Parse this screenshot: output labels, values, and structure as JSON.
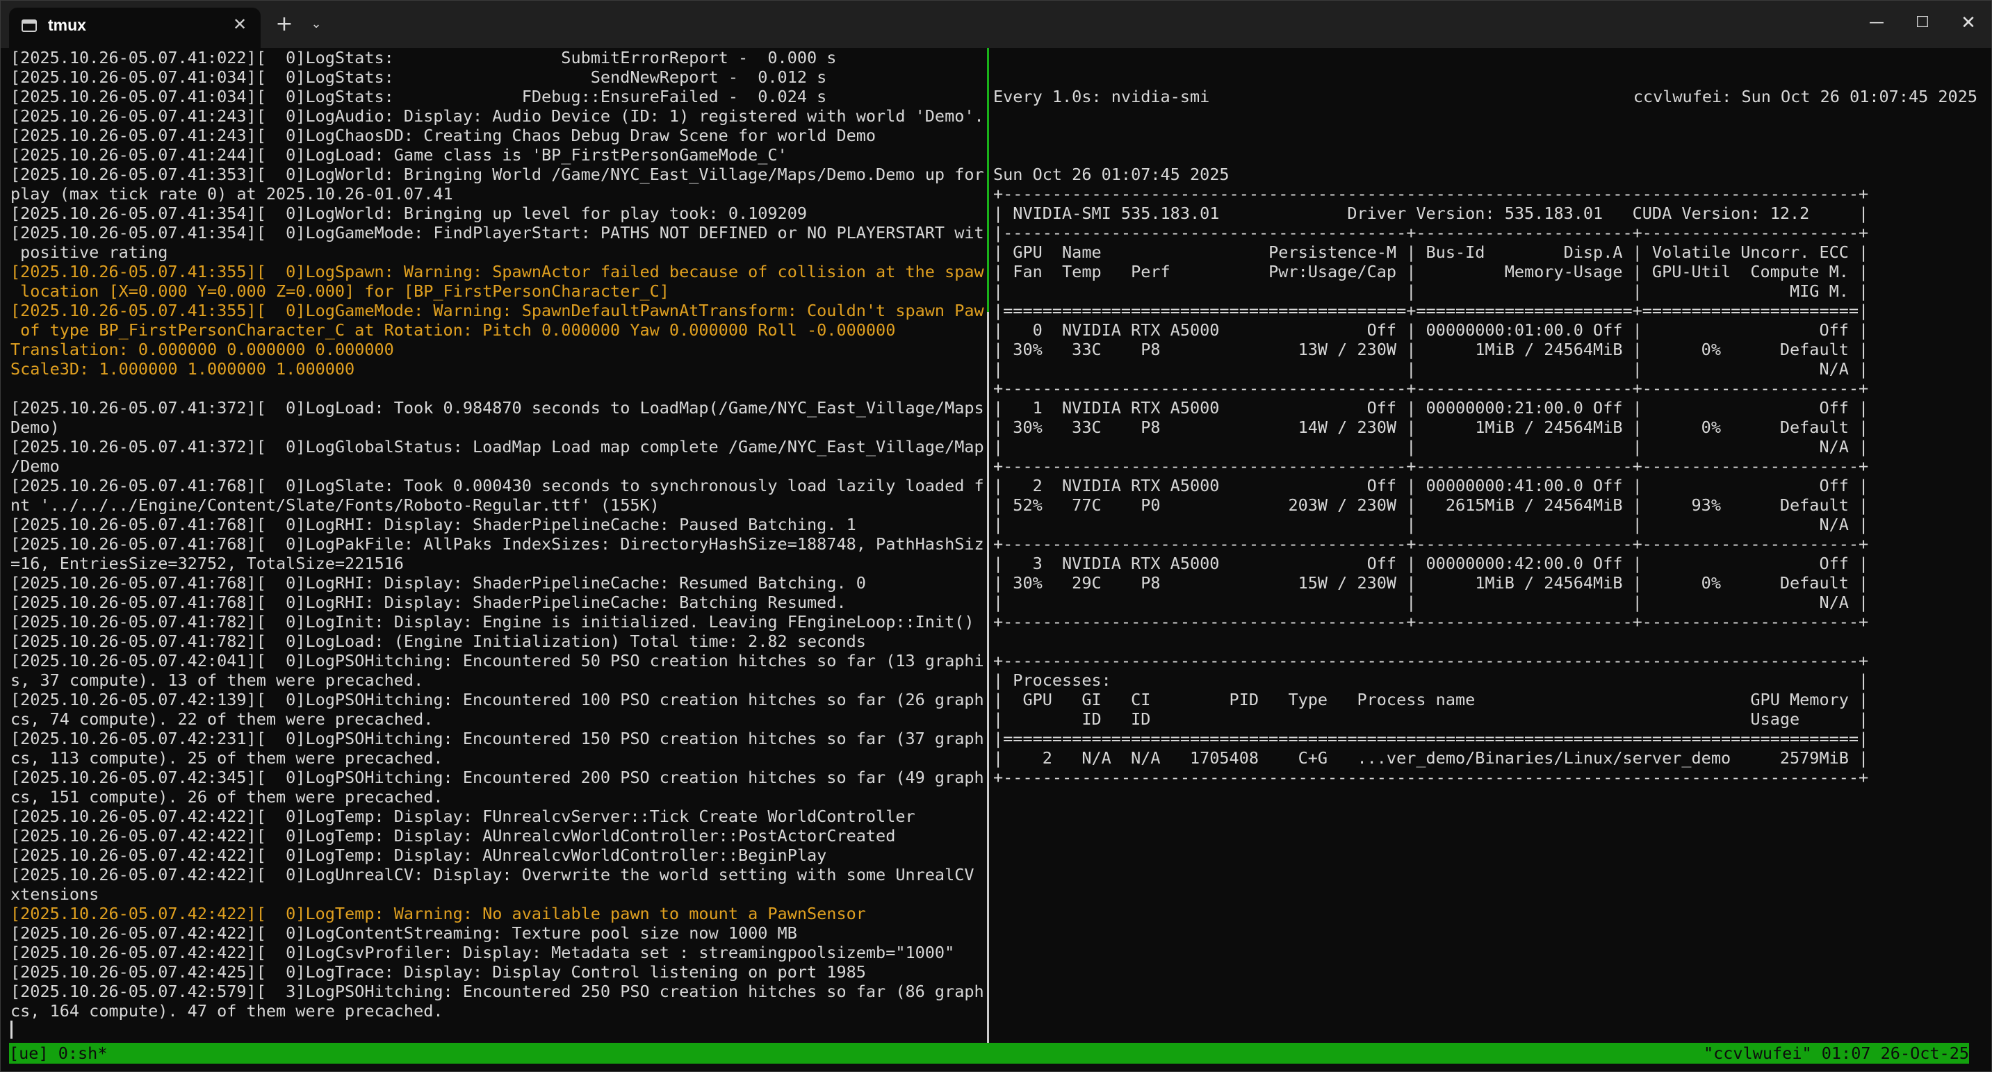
{
  "window": {
    "tab_title": "tmux",
    "tab_close_glyph": "✕",
    "new_tab_glyph": "+",
    "dropdown_glyph": "⌄",
    "minimize_glyph": "—",
    "maximize_glyph": "☐",
    "close_glyph": "✕",
    "icons": {
      "tab": "terminal-icon",
      "close": "close-icon",
      "new_tab": "plus-icon",
      "dropdown": "chevron-down-icon"
    }
  },
  "colors": {
    "background": "#0c0c0c",
    "text": "#d8d8d8",
    "warning": "#e0a020",
    "status_bar": "#13a10e",
    "active_divider": "#19b319"
  },
  "left_pane": {
    "lines": [
      {
        "text": "[2025.10.26-05.07.41:022][  0]LogStats:                 SubmitErrorReport -  0.000 s",
        "warn": false
      },
      {
        "text": "[2025.10.26-05.07.41:034][  0]LogStats:                    SendNewReport -  0.012 s",
        "warn": false
      },
      {
        "text": "[2025.10.26-05.07.41:034][  0]LogStats:             FDebug::EnsureFailed -  0.024 s",
        "warn": false
      },
      {
        "text": "[2025.10.26-05.07.41:243][  0]LogAudio: Display: Audio Device (ID: 1) registered with world 'Demo'.",
        "warn": false
      },
      {
        "text": "[2025.10.26-05.07.41:243][  0]LogChaosDD: Creating Chaos Debug Draw Scene for world Demo",
        "warn": false
      },
      {
        "text": "[2025.10.26-05.07.41:244][  0]LogLoad: Game class is 'BP_FirstPersonGameMode_C'",
        "warn": false
      },
      {
        "text": "[2025.10.26-05.07.41:353][  0]LogWorld: Bringing World /Game/NYC_East_Village/Maps/Demo.Demo up for",
        "warn": false
      },
      {
        "text": "play (max tick rate 0) at 2025.10.26-01.07.41",
        "warn": false
      },
      {
        "text": "[2025.10.26-05.07.41:354][  0]LogWorld: Bringing up level for play took: 0.109209",
        "warn": false
      },
      {
        "text": "[2025.10.26-05.07.41:354][  0]LogGameMode: FindPlayerStart: PATHS NOT DEFINED or NO PLAYERSTART with",
        "warn": false
      },
      {
        "text": " positive rating",
        "warn": false
      },
      {
        "text": "[2025.10.26-05.07.41:355][  0]LogSpawn: Warning: SpawnActor failed because of collision at the spawn",
        "warn": true
      },
      {
        "text": " location [X=0.000 Y=0.000 Z=0.000] for [BP_FirstPersonCharacter_C]",
        "warn": true
      },
      {
        "text": "[2025.10.26-05.07.41:355][  0]LogGameMode: Warning: SpawnDefaultPawnAtTransform: Couldn't spawn Pawn",
        "warn": true
      },
      {
        "text": " of type BP_FirstPersonCharacter_C at Rotation: Pitch 0.000000 Yaw 0.000000 Roll -0.000000",
        "warn": true
      },
      {
        "text": "Translation: 0.000000 0.000000 0.000000",
        "warn": true
      },
      {
        "text": "Scale3D: 1.000000 1.000000 1.000000",
        "warn": true
      },
      {
        "text": "",
        "warn": false
      },
      {
        "text": "[2025.10.26-05.07.41:372][  0]LogLoad: Took 0.984870 seconds to LoadMap(/Game/NYC_East_Village/Maps/",
        "warn": false
      },
      {
        "text": "Demo)",
        "warn": false
      },
      {
        "text": "[2025.10.26-05.07.41:372][  0]LogGlobalStatus: LoadMap Load map complete /Game/NYC_East_Village/Maps",
        "warn": false
      },
      {
        "text": "/Demo",
        "warn": false
      },
      {
        "text": "[2025.10.26-05.07.41:768][  0]LogSlate: Took 0.000430 seconds to synchronously load lazily loaded fo",
        "warn": false
      },
      {
        "text": "nt '../../../Engine/Content/Slate/Fonts/Roboto-Regular.ttf' (155K)",
        "warn": false
      },
      {
        "text": "[2025.10.26-05.07.41:768][  0]LogRHI: Display: ShaderPipelineCache: Paused Batching. 1",
        "warn": false
      },
      {
        "text": "[2025.10.26-05.07.41:768][  0]LogPakFile: AllPaks IndexSizes: DirectoryHashSize=188748, PathHashSize",
        "warn": false
      },
      {
        "text": "=16, EntriesSize=32752, TotalSize=221516",
        "warn": false
      },
      {
        "text": "[2025.10.26-05.07.41:768][  0]LogRHI: Display: ShaderPipelineCache: Resumed Batching. 0",
        "warn": false
      },
      {
        "text": "[2025.10.26-05.07.41:768][  0]LogRHI: Display: ShaderPipelineCache: Batching Resumed.",
        "warn": false
      },
      {
        "text": "[2025.10.26-05.07.41:782][  0]LogInit: Display: Engine is initialized. Leaving FEngineLoop::Init()",
        "warn": false
      },
      {
        "text": "[2025.10.26-05.07.41:782][  0]LogLoad: (Engine Initialization) Total time: 2.82 seconds",
        "warn": false
      },
      {
        "text": "[2025.10.26-05.07.42:041][  0]LogPSOHitching: Encountered 50 PSO creation hitches so far (13 graphic",
        "warn": false
      },
      {
        "text": "s, 37 compute). 13 of them were precached.",
        "warn": false
      },
      {
        "text": "[2025.10.26-05.07.42:139][  0]LogPSOHitching: Encountered 100 PSO creation hitches so far (26 graphi",
        "warn": false
      },
      {
        "text": "cs, 74 compute). 22 of them were precached.",
        "warn": false
      },
      {
        "text": "[2025.10.26-05.07.42:231][  0]LogPSOHitching: Encountered 150 PSO creation hitches so far (37 graphi",
        "warn": false
      },
      {
        "text": "cs, 113 compute). 25 of them were precached.",
        "warn": false
      },
      {
        "text": "[2025.10.26-05.07.42:345][  0]LogPSOHitching: Encountered 200 PSO creation hitches so far (49 graphi",
        "warn": false
      },
      {
        "text": "cs, 151 compute). 26 of them were precached.",
        "warn": false
      },
      {
        "text": "[2025.10.26-05.07.42:422][  0]LogTemp: Display: FUnrealcvServer::Tick Create WorldController",
        "warn": false
      },
      {
        "text": "[2025.10.26-05.07.42:422][  0]LogTemp: Display: AUnrealcvWorldController::PostActorCreated",
        "warn": false
      },
      {
        "text": "[2025.10.26-05.07.42:422][  0]LogTemp: Display: AUnrealcvWorldController::BeginPlay",
        "warn": false
      },
      {
        "text": "[2025.10.26-05.07.42:422][  0]LogUnrealCV: Display: Overwrite the world setting with some UnrealCV e",
        "warn": false
      },
      {
        "text": "xtensions",
        "warn": false
      },
      {
        "text": "[2025.10.26-05.07.42:422][  0]LogTemp: Warning: No available pawn to mount a PawnSensor",
        "warn": true
      },
      {
        "text": "[2025.10.26-05.07.42:422][  0]LogContentStreaming: Texture pool size now 1000 MB",
        "warn": false
      },
      {
        "text": "[2025.10.26-05.07.42:422][  0]LogCsvProfiler: Display: Metadata set : streamingpoolsizemb=\"1000\"",
        "warn": false
      },
      {
        "text": "[2025.10.26-05.07.42:425][  0]LogTrace: Display: Display Control listening on port 1985",
        "warn": false
      },
      {
        "text": "[2025.10.26-05.07.42:579][  3]LogPSOHitching: Encountered 250 PSO creation hitches so far (86 graphi",
        "warn": false
      },
      {
        "text": "cs, 164 compute). 47 of them were precached.",
        "warn": false
      }
    ]
  },
  "right_pane": {
    "watch_command": "Every 1.0s: nvidia-smi",
    "watch_host_time": "ccvlwufei: Sun Oct 26 01:07:45 2025",
    "lines": [
      "",
      "Sun Oct 26 01:07:45 2025",
      "+---------------------------------------------------------------------------------------+",
      "| NVIDIA-SMI 535.183.01             Driver Version: 535.183.01   CUDA Version: 12.2     |",
      "|-----------------------------------------+----------------------+----------------------+",
      "| GPU  Name                 Persistence-M | Bus-Id        Disp.A | Volatile Uncorr. ECC |",
      "| Fan  Temp   Perf          Pwr:Usage/Cap |         Memory-Usage | GPU-Util  Compute M. |",
      "|                                         |                      |               MIG M. |",
      "|=========================================+======================+======================|",
      "|   0  NVIDIA RTX A5000               Off | 00000000:01:00.0 Off |                  Off |",
      "| 30%   33C    P8              13W / 230W |      1MiB / 24564MiB |      0%      Default |",
      "|                                         |                      |                  N/A |",
      "+-----------------------------------------+----------------------+----------------------+",
      "|   1  NVIDIA RTX A5000               Off | 00000000:21:00.0 Off |                  Off |",
      "| 30%   33C    P8              14W / 230W |      1MiB / 24564MiB |      0%      Default |",
      "|                                         |                      |                  N/A |",
      "+-----------------------------------------+----------------------+----------------------+",
      "|   2  NVIDIA RTX A5000               Off | 00000000:41:00.0 Off |                  Off |",
      "| 52%   77C    P0             203W / 230W |   2615MiB / 24564MiB |     93%      Default |",
      "|                                         |                      |                  N/A |",
      "+-----------------------------------------+----------------------+----------------------+",
      "|   3  NVIDIA RTX A5000               Off | 00000000:42:00.0 Off |                  Off |",
      "| 30%   29C    P8              15W / 230W |      1MiB / 24564MiB |      0%      Default |",
      "|                                         |                      |                  N/A |",
      "+-----------------------------------------+----------------------+----------------------+",
      "",
      "+---------------------------------------------------------------------------------------+",
      "| Processes:                                                                            |",
      "|  GPU   GI   CI        PID   Type   Process name                            GPU Memory |",
      "|        ID   ID                                                             Usage      |",
      "|=======================================================================================|",
      "|    2   N/A  N/A   1705408    C+G   ...ver_demo/Binaries/Linux/server_demo     2579MiB |",
      "+---------------------------------------------------------------------------------------+"
    ]
  },
  "status_bar": {
    "left": "[ue] 0:sh*",
    "right": "\"ccvlwufei\" 01:07 26-Oct-25"
  }
}
